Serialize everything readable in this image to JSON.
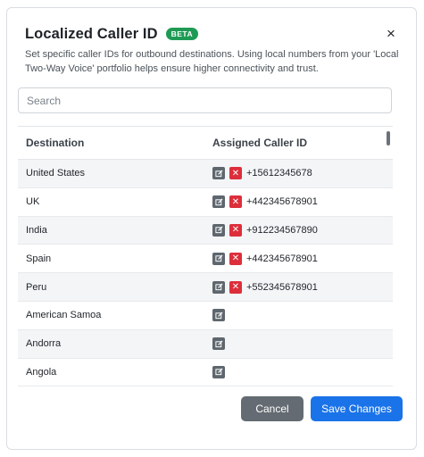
{
  "dialog": {
    "title": "Localized Caller ID",
    "badge": "BETA",
    "close_icon": "×",
    "description": "Set specific caller IDs for outbound destinations. Using local numbers from your 'Local Two-Way Voice' portfolio helps ensure higher connectivity and trust."
  },
  "search": {
    "placeholder": "Search",
    "value": ""
  },
  "table": {
    "headers": {
      "destination": "Destination",
      "caller_id": "Assigned Caller ID"
    },
    "rows": [
      {
        "destination": "United States",
        "caller_id": "+15612345678"
      },
      {
        "destination": "UK",
        "caller_id": "+442345678901"
      },
      {
        "destination": "India",
        "caller_id": "+912234567890"
      },
      {
        "destination": "Spain",
        "caller_id": "+442345678901"
      },
      {
        "destination": "Peru",
        "caller_id": "+552345678901"
      },
      {
        "destination": "American Samoa",
        "caller_id": ""
      },
      {
        "destination": "Andorra",
        "caller_id": ""
      },
      {
        "destination": "Angola",
        "caller_id": ""
      }
    ]
  },
  "footer": {
    "cancel_label": "Cancel",
    "save_label": "Save Changes"
  },
  "colors": {
    "accent": "#1a73e8",
    "badge": "#1f9a55",
    "delete": "#dc2f3b",
    "edit": "#5f676e"
  }
}
